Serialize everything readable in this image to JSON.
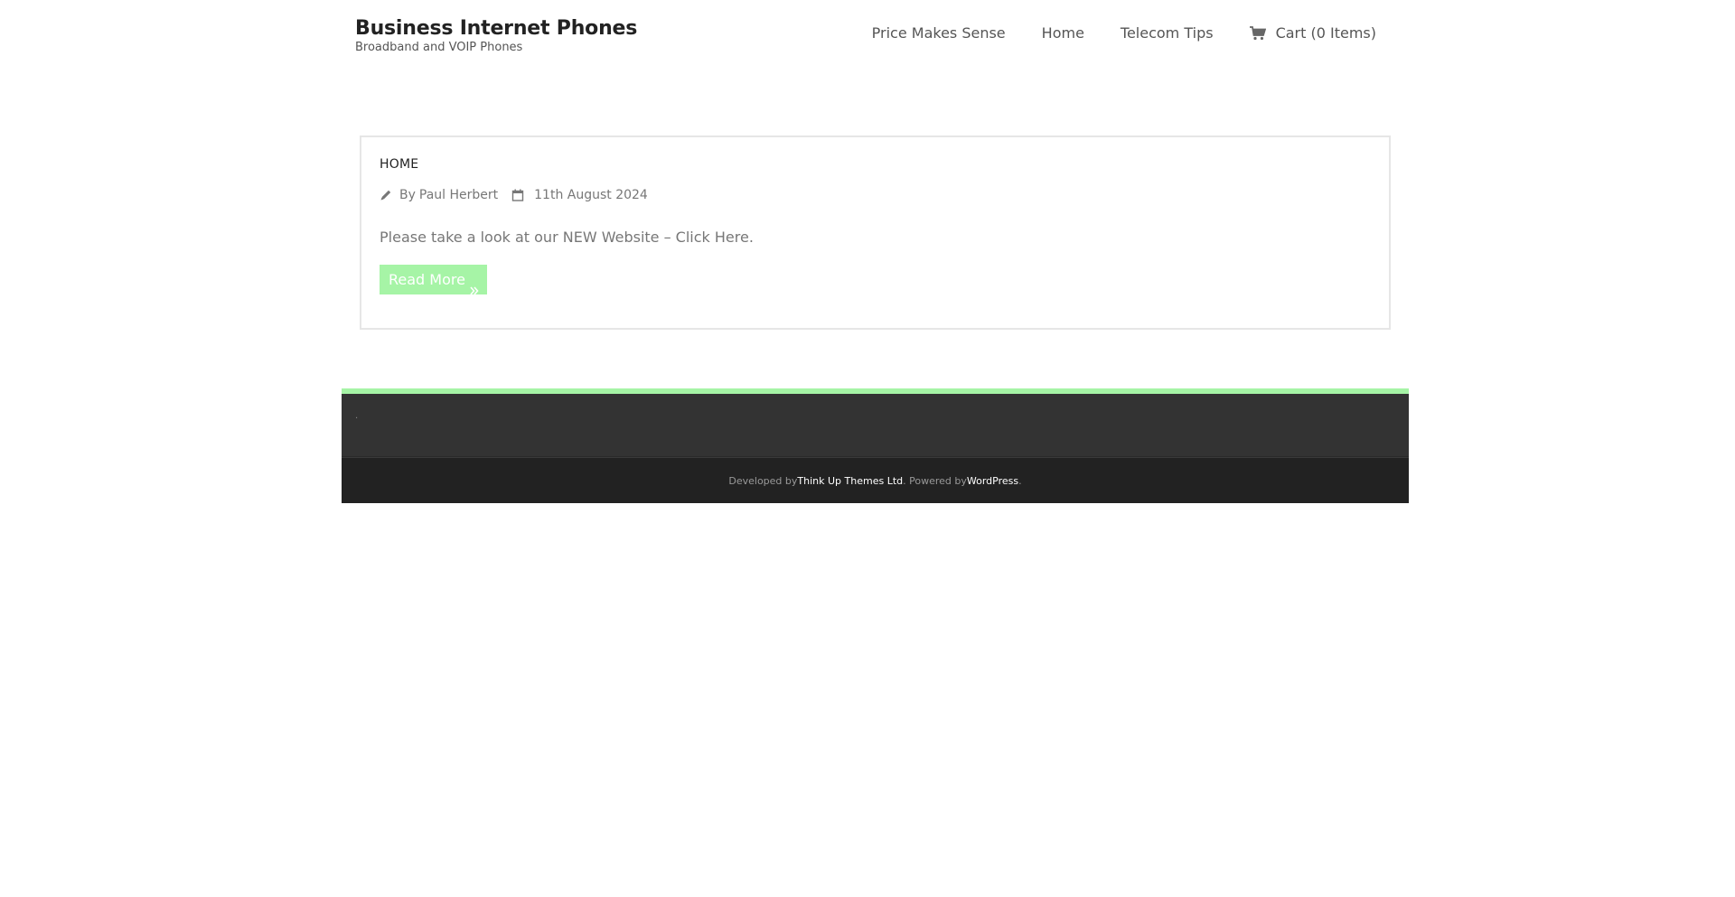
{
  "header": {
    "site_title": "Business Internet Phones",
    "tagline": "Broadband and VOIP Phones",
    "nav": [
      {
        "label": "Price Makes Sense"
      },
      {
        "label": "Home"
      },
      {
        "label": "Telecom Tips"
      },
      {
        "label": "Cart (0 Items)",
        "icon": "cart-icon"
      }
    ]
  },
  "post": {
    "title": "HOME",
    "author_prefix": "By",
    "author": "Paul Herbert",
    "author_icon": "pencil-icon",
    "date": "11th August 2024",
    "date_icon": "calendar-icon",
    "excerpt_text": "Please take a look at our NEW Website – ",
    "excerpt_link": "Click Here.",
    "read_more": "Read More",
    "read_more_icon": "double-chevron-right-icon"
  },
  "footer": {
    "widget_text": ".",
    "developed_by_prefix": "Developed by ",
    "developer": "Think Up Themes Ltd",
    "powered_by_prefix": ". Powered by ",
    "powered_by": "WordPress",
    "suffix": "."
  },
  "colors": {
    "accent": "#a6f4a6",
    "footer_widgets_bg": "#333333",
    "footer_bottom_bg": "#222222"
  }
}
